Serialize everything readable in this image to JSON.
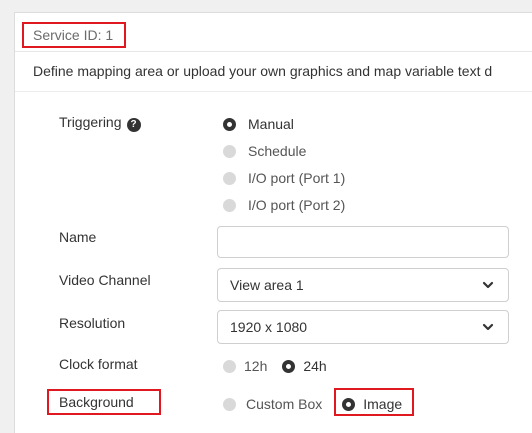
{
  "header": {
    "service_id": "Service ID: 1",
    "description": "Define mapping area or upload your own graphics and map variable text d"
  },
  "triggering": {
    "label": "Triggering",
    "help_icon": "question-circle-icon",
    "options": [
      {
        "label": "Manual",
        "selected": true
      },
      {
        "label": "Schedule",
        "selected": false
      },
      {
        "label": "I/O port (Port 1)",
        "selected": false
      },
      {
        "label": "I/O port (Port 2)",
        "selected": false
      }
    ]
  },
  "name": {
    "label": "Name",
    "value": ""
  },
  "video_channel": {
    "label": "Video Channel",
    "value": "View area 1"
  },
  "resolution": {
    "label": "Resolution",
    "value": "1920 x 1080"
  },
  "clock_format": {
    "label": "Clock format",
    "options": [
      {
        "label": "12h",
        "selected": false
      },
      {
        "label": "24h",
        "selected": true
      }
    ]
  },
  "background": {
    "label": "Background",
    "options": [
      {
        "label": "Custom Box",
        "selected": false
      },
      {
        "label": "Image",
        "selected": true
      }
    ]
  },
  "colors": {
    "highlight": "#e0181f",
    "text": "#333333",
    "radio_unchecked": "#d9d9d9"
  }
}
